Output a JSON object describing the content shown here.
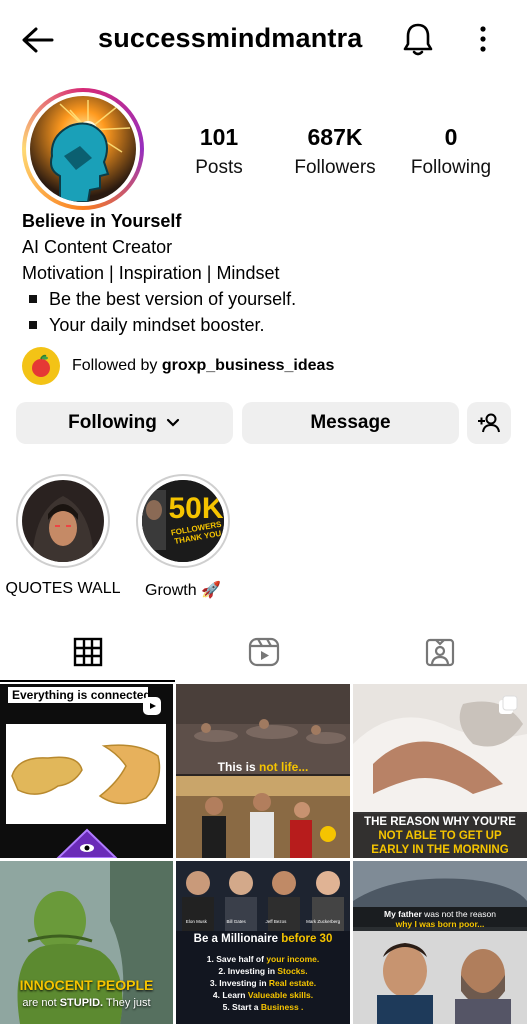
{
  "header": {
    "username": "successmindmantra",
    "back_icon": "arrow-left-icon",
    "bell_icon": "bell-icon",
    "more_icon": "more-vertical-icon"
  },
  "stats": {
    "posts_count": "101",
    "posts_label": "Posts",
    "followers_count": "687K",
    "followers_label": "Followers",
    "following_count": "0",
    "following_label": "Following"
  },
  "bio": {
    "name": "Believe in Yourself",
    "category": "AI Content Creator",
    "line1": "Motivation | Inspiration | Mindset",
    "bullets": [
      "Be the best version of yourself.",
      "Your daily mindset booster."
    ]
  },
  "followed_by": {
    "prefix": "Followed by ",
    "account": "groxp_business_ideas"
  },
  "actions": {
    "following_label": "Following",
    "message_label": "Message",
    "add_person_icon": "add-person-icon"
  },
  "highlights": [
    {
      "label": "QUOTES WALL"
    },
    {
      "label": "Growth 🚀",
      "badge_big": "50K",
      "badge_small1": "FOLLOWERS",
      "badge_small2": "THANK YOU"
    }
  ],
  "tabs": [
    {
      "icon": "grid-icon",
      "active": true
    },
    {
      "icon": "reels-icon",
      "active": false
    },
    {
      "icon": "tagged-icon",
      "active": false
    }
  ],
  "posts": [
    {
      "caption": "Everything is connected"
    },
    {
      "caption_prefix": "This is ",
      "caption_highlight": "not life..."
    },
    {
      "caption_line1": "THE REASON WHY YOU'RE",
      "caption_line2": "NOT ABLE TO GET UP",
      "caption_line3": "EARLY IN THE MORNING"
    },
    {
      "caption_line1": "INNOCENT PEOPLE",
      "caption_line2_a": "are not ",
      "caption_line2_b": "STUPID.",
      "caption_line2_c": " They just"
    },
    {
      "title_prefix": "Be a Millionaire ",
      "title_highlight": "before 30",
      "faces": [
        "Elon Musk",
        "Bill Gates",
        "Jeff Bezos",
        "Mark Zuckerberg"
      ],
      "steps": [
        {
          "pre": "1. Save half of ",
          "hi": "your income."
        },
        {
          "pre": "2. Investing in ",
          "hi": "Stocks."
        },
        {
          "pre": "3. Investing in ",
          "hi": "Real estate."
        },
        {
          "pre": "4. Learn ",
          "hi": "Valueable skills."
        },
        {
          "pre": "5. Start a ",
          "hi": "Business ."
        }
      ]
    },
    {
      "caption_line1_a": "My father ",
      "caption_line1_b": "was not the reason",
      "caption_line2": "why I was born poor..."
    }
  ],
  "colors": {
    "button_bg": "#efefef",
    "accent_yellow": "#f5c400",
    "accent_red": "#e53935"
  }
}
